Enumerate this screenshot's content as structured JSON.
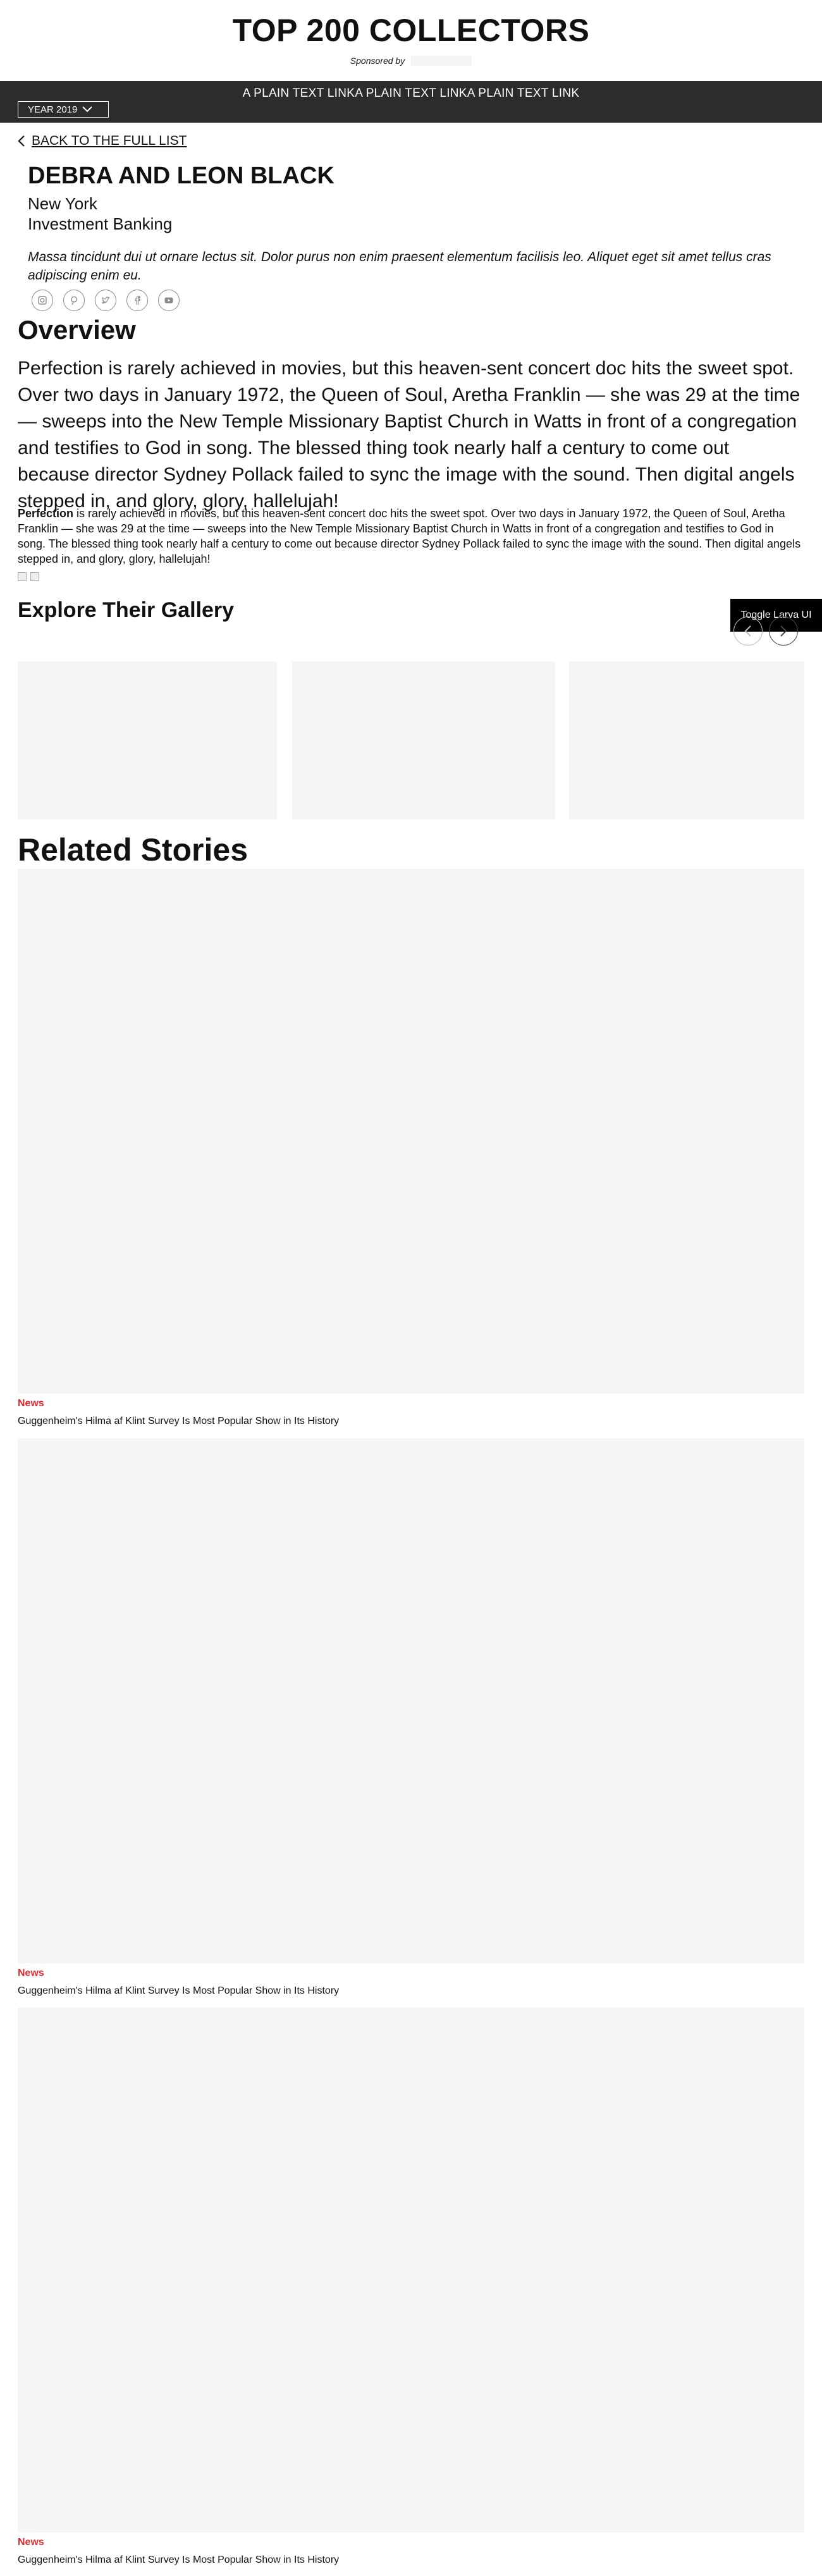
{
  "masthead": {
    "title": "TOP 200 COLLECTORS",
    "sponsored_by": "Sponsored by"
  },
  "navbar": {
    "links": "A PLAIN TEXT LINKA PLAIN TEXT LINKA PLAIN TEXT LINK",
    "year_label": "YEAR 2019"
  },
  "back_link": "BACK TO THE FULL LIST",
  "profile": {
    "name": "DEBRA AND LEON BLACK",
    "location": "New York",
    "industry": "Investment Banking",
    "quote": "Massa tincidunt dui ut ornare lectus sit. Dolor purus non enim praesent elementum facilisis leo. Aliquet eget sit amet tellus cras adipiscing enim eu."
  },
  "social_icons": [
    "instagram-icon",
    "pinterest-icon",
    "twitter-icon",
    "facebook-icon",
    "youtube-icon"
  ],
  "overview": {
    "title": "Overview",
    "lead": "Perfection is rarely achieved in movies, but this heaven-sent concert doc hits the sweet spot. Over two days in January 1972, the Queen of Soul, Aretha Franklin — she was 29 at the time — sweeps into the New Temple Missionary Baptist Church in Watts in front of a congregation and testifies to God in song. The blessed thing took nearly half a century to come out because director Sydney Pollack failed to sync the image with the sound. Then digital angels stepped in, and glory, glory, hallelujah!",
    "body_bold": "Perfection",
    "body_rest": " is rarely achieved in movies, but this heaven-sent concert doc hits the sweet spot. Over two days in January 1972, the Queen of Soul, Aretha Franklin — she was 29 at the time — sweeps into the New Temple Missionary Baptist Church in Watts in front of a congregation and testifies to God in song. The blessed thing took nearly half a century to come out because director Sydney Pollack failed to sync the image with the sound. Then digital angels stepped in, and glory, glory, hallelujah!"
  },
  "gallery": {
    "title": "Explore Their Gallery",
    "toggle_label": "Toggle Larva UI"
  },
  "related": {
    "title": "Related Stories",
    "stories": [
      {
        "category": "News",
        "title": "Guggenheim's Hilma af Klint Survey Is Most Popular Show in Its History"
      },
      {
        "category": "News",
        "title": "Guggenheim's Hilma af Klint Survey Is Most Popular Show in Its History"
      },
      {
        "category": "News",
        "title": "Guggenheim's Hilma af Klint Survey Is Most Popular Show in Its History"
      }
    ]
  },
  "colors": {
    "navbar_bg": "#2c2c2c",
    "accent_red": "#e0292f",
    "placeholder_bg": "#f5f5f5"
  }
}
